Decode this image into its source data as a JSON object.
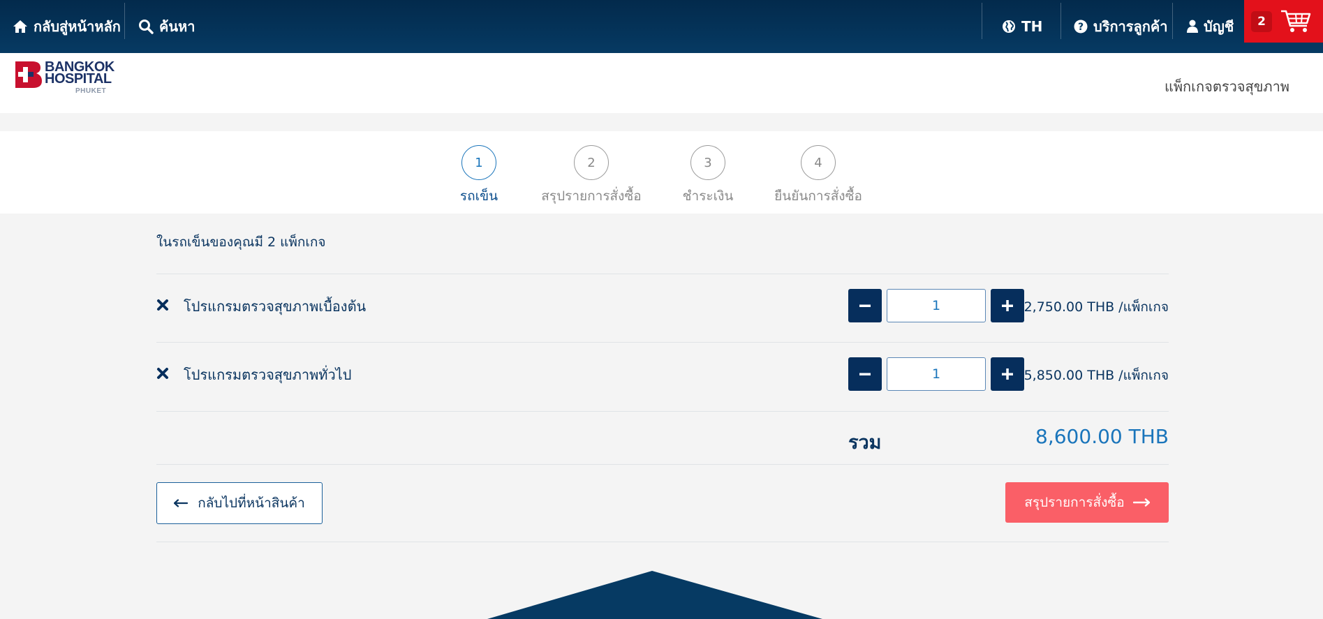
{
  "topbar": {
    "home_label": "กลับสู่หน้าหลัก",
    "search_label": "ค้นหา",
    "language_label": "TH",
    "service_label": "บริการลูกค้า",
    "account_label": "บัญชี",
    "cart_count": "2"
  },
  "header": {
    "logo_line1": "BANGKOK",
    "logo_line2": "HOSPITAL",
    "logo_line3": "PHUKET",
    "nav_link": "แพ็กเกจตรวจสุขภาพ"
  },
  "steps": [
    {
      "number": "1",
      "label": "รถเข็น"
    },
    {
      "number": "2",
      "label": "สรุปรายการสั่งซื้อ"
    },
    {
      "number": "3",
      "label": "ชำระเงิน"
    },
    {
      "number": "4",
      "label": "ยืนยันการสั่งซื้อ"
    }
  ],
  "cart": {
    "summary": "ในรถเข็นของคุณมี 2 แพ็กเกจ",
    "items": [
      {
        "name": "โปรแกรมตรวจสุขภาพเบื้องต้น",
        "quantity": "1",
        "price": "2,750.00 THB /แพ็กเกจ"
      },
      {
        "name": "โปรแกรมตรวจสุขภาพทั่วไป",
        "quantity": "1",
        "price": "5,850.00 THB /แพ็กเกจ"
      }
    ],
    "total_label": "รวม",
    "total_value": "8,600.00 THB",
    "back_label": "กลับไปที่หน้าสินค้า",
    "next_label": "สรุปรายการสั่งซื้อ"
  },
  "colors": {
    "navy": "#062e5c",
    "accent_blue": "#1a75bb",
    "cart_red": "#e3111b",
    "cta_coral": "#fa5f67"
  }
}
